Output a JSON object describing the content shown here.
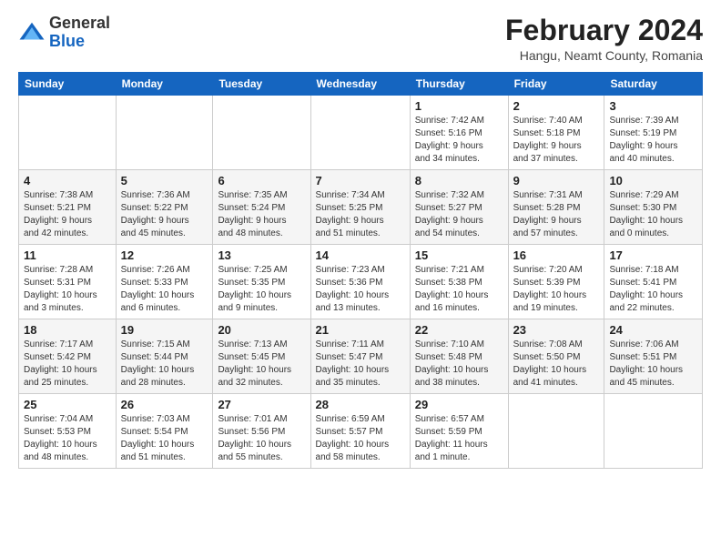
{
  "header": {
    "logo": {
      "general": "General",
      "blue": "Blue"
    },
    "title": "February 2024",
    "location": "Hangu, Neamt County, Romania"
  },
  "weekdays": [
    "Sunday",
    "Monday",
    "Tuesday",
    "Wednesday",
    "Thursday",
    "Friday",
    "Saturday"
  ],
  "weeks": [
    [
      {
        "day": "",
        "info": ""
      },
      {
        "day": "",
        "info": ""
      },
      {
        "day": "",
        "info": ""
      },
      {
        "day": "",
        "info": ""
      },
      {
        "day": "1",
        "info": "Sunrise: 7:42 AM\nSunset: 5:16 PM\nDaylight: 9 hours\nand 34 minutes."
      },
      {
        "day": "2",
        "info": "Sunrise: 7:40 AM\nSunset: 5:18 PM\nDaylight: 9 hours\nand 37 minutes."
      },
      {
        "day": "3",
        "info": "Sunrise: 7:39 AM\nSunset: 5:19 PM\nDaylight: 9 hours\nand 40 minutes."
      }
    ],
    [
      {
        "day": "4",
        "info": "Sunrise: 7:38 AM\nSunset: 5:21 PM\nDaylight: 9 hours\nand 42 minutes."
      },
      {
        "day": "5",
        "info": "Sunrise: 7:36 AM\nSunset: 5:22 PM\nDaylight: 9 hours\nand 45 minutes."
      },
      {
        "day": "6",
        "info": "Sunrise: 7:35 AM\nSunset: 5:24 PM\nDaylight: 9 hours\nand 48 minutes."
      },
      {
        "day": "7",
        "info": "Sunrise: 7:34 AM\nSunset: 5:25 PM\nDaylight: 9 hours\nand 51 minutes."
      },
      {
        "day": "8",
        "info": "Sunrise: 7:32 AM\nSunset: 5:27 PM\nDaylight: 9 hours\nand 54 minutes."
      },
      {
        "day": "9",
        "info": "Sunrise: 7:31 AM\nSunset: 5:28 PM\nDaylight: 9 hours\nand 57 minutes."
      },
      {
        "day": "10",
        "info": "Sunrise: 7:29 AM\nSunset: 5:30 PM\nDaylight: 10 hours\nand 0 minutes."
      }
    ],
    [
      {
        "day": "11",
        "info": "Sunrise: 7:28 AM\nSunset: 5:31 PM\nDaylight: 10 hours\nand 3 minutes."
      },
      {
        "day": "12",
        "info": "Sunrise: 7:26 AM\nSunset: 5:33 PM\nDaylight: 10 hours\nand 6 minutes."
      },
      {
        "day": "13",
        "info": "Sunrise: 7:25 AM\nSunset: 5:35 PM\nDaylight: 10 hours\nand 9 minutes."
      },
      {
        "day": "14",
        "info": "Sunrise: 7:23 AM\nSunset: 5:36 PM\nDaylight: 10 hours\nand 13 minutes."
      },
      {
        "day": "15",
        "info": "Sunrise: 7:21 AM\nSunset: 5:38 PM\nDaylight: 10 hours\nand 16 minutes."
      },
      {
        "day": "16",
        "info": "Sunrise: 7:20 AM\nSunset: 5:39 PM\nDaylight: 10 hours\nand 19 minutes."
      },
      {
        "day": "17",
        "info": "Sunrise: 7:18 AM\nSunset: 5:41 PM\nDaylight: 10 hours\nand 22 minutes."
      }
    ],
    [
      {
        "day": "18",
        "info": "Sunrise: 7:17 AM\nSunset: 5:42 PM\nDaylight: 10 hours\nand 25 minutes."
      },
      {
        "day": "19",
        "info": "Sunrise: 7:15 AM\nSunset: 5:44 PM\nDaylight: 10 hours\nand 28 minutes."
      },
      {
        "day": "20",
        "info": "Sunrise: 7:13 AM\nSunset: 5:45 PM\nDaylight: 10 hours\nand 32 minutes."
      },
      {
        "day": "21",
        "info": "Sunrise: 7:11 AM\nSunset: 5:47 PM\nDaylight: 10 hours\nand 35 minutes."
      },
      {
        "day": "22",
        "info": "Sunrise: 7:10 AM\nSunset: 5:48 PM\nDaylight: 10 hours\nand 38 minutes."
      },
      {
        "day": "23",
        "info": "Sunrise: 7:08 AM\nSunset: 5:50 PM\nDaylight: 10 hours\nand 41 minutes."
      },
      {
        "day": "24",
        "info": "Sunrise: 7:06 AM\nSunset: 5:51 PM\nDaylight: 10 hours\nand 45 minutes."
      }
    ],
    [
      {
        "day": "25",
        "info": "Sunrise: 7:04 AM\nSunset: 5:53 PM\nDaylight: 10 hours\nand 48 minutes."
      },
      {
        "day": "26",
        "info": "Sunrise: 7:03 AM\nSunset: 5:54 PM\nDaylight: 10 hours\nand 51 minutes."
      },
      {
        "day": "27",
        "info": "Sunrise: 7:01 AM\nSunset: 5:56 PM\nDaylight: 10 hours\nand 55 minutes."
      },
      {
        "day": "28",
        "info": "Sunrise: 6:59 AM\nSunset: 5:57 PM\nDaylight: 10 hours\nand 58 minutes."
      },
      {
        "day": "29",
        "info": "Sunrise: 6:57 AM\nSunset: 5:59 PM\nDaylight: 11 hours\nand 1 minute."
      },
      {
        "day": "",
        "info": ""
      },
      {
        "day": "",
        "info": ""
      }
    ]
  ]
}
